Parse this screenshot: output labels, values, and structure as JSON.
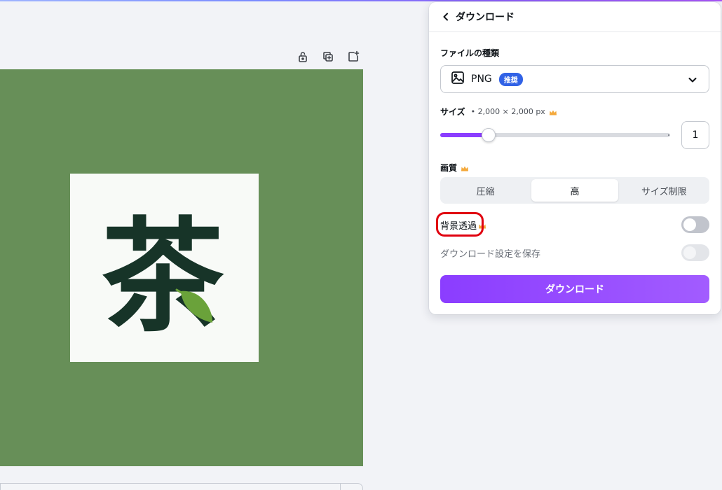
{
  "toolbar": {
    "icons": [
      "lock-open-icon",
      "duplicate-page-icon",
      "add-page-icon"
    ]
  },
  "canvas": {
    "background_color": "#678f58",
    "card_color": "#f8faf7",
    "logo": {
      "glyph": "茶",
      "glyph_color": "#173428",
      "leaf_color": "#6aa23a"
    }
  },
  "panel": {
    "title": "ダウンロード",
    "file_type": {
      "label": "ファイルの種類",
      "value": "PNG",
      "badge": "推奨"
    },
    "size": {
      "label": "サイズ",
      "dimensions": "• 2,000 × 2,000 px",
      "slider_fraction": 0.21,
      "multiplier": "1"
    },
    "quality": {
      "label": "画質",
      "options": [
        "圧縮",
        "高",
        "サイズ制限"
      ],
      "selected": "高"
    },
    "transparent_bg": {
      "label": "背景透過",
      "enabled": false
    },
    "save_settings": {
      "label": "ダウンロード設定を保存",
      "enabled": false,
      "disabled": true
    },
    "download_button": "ダウンロード"
  },
  "colors": {
    "accent": "#8b3dff",
    "badge": "#3162e6",
    "crown": "#f4a93b",
    "highlight": "#e0000f"
  }
}
